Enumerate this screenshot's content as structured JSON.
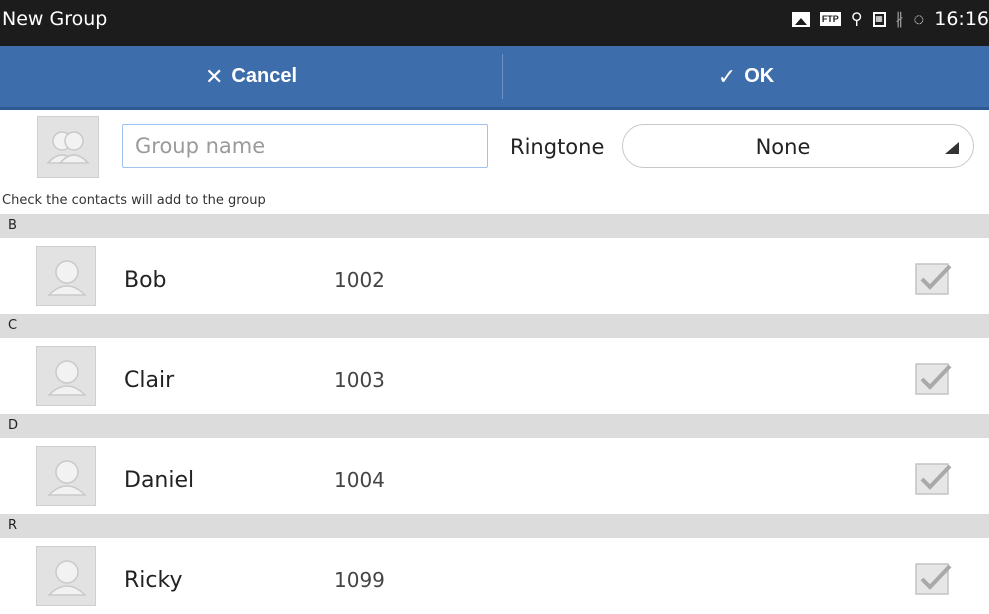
{
  "status_bar": {
    "title": "New Group",
    "icons": [
      "image-icon",
      "ftp-icon",
      "usb-icon",
      "sim-icon",
      "bluetooth-icon",
      "sync-icon"
    ],
    "ftp_text": "FTP",
    "time": "16:16"
  },
  "action_bar": {
    "cancel_label": "Cancel",
    "ok_label": "OK"
  },
  "group": {
    "name_placeholder": "Group name",
    "name_value": "",
    "ringtone_label": "Ringtone",
    "ringtone_value": "None"
  },
  "hint": "Check the contacts will add to the group",
  "sections": [
    {
      "letter": "B",
      "contacts": [
        {
          "name": "Bob",
          "number": "1002",
          "checked": true
        }
      ]
    },
    {
      "letter": "C",
      "contacts": [
        {
          "name": "Clair",
          "number": "1003",
          "checked": true
        }
      ]
    },
    {
      "letter": "D",
      "contacts": [
        {
          "name": "Daniel",
          "number": "1004",
          "checked": true
        }
      ]
    },
    {
      "letter": "R",
      "contacts": [
        {
          "name": "Ricky",
          "number": "1099",
          "checked": true
        }
      ]
    }
  ],
  "colors": {
    "status_bar": "#1c1c1c",
    "action_bar": "#3e6dab",
    "section_header": "#dcdcdc",
    "input_border": "#9ec3ee"
  }
}
